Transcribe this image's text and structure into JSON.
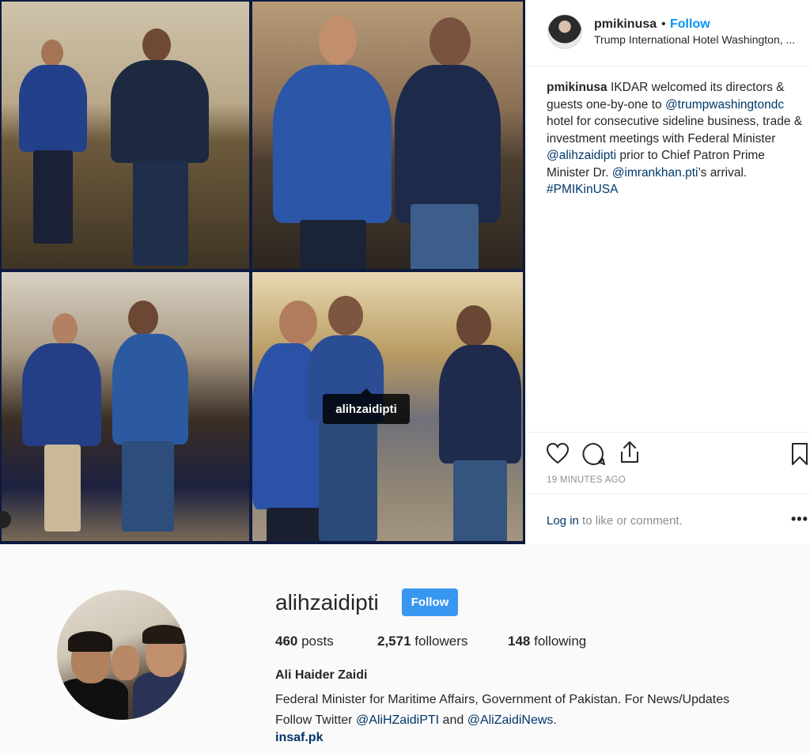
{
  "post": {
    "header": {
      "username": "pmikinusa",
      "separator": "•",
      "follow_label": "Follow",
      "location": "Trump International Hotel Washington, ..."
    },
    "caption": {
      "username": "pmikinusa",
      "text_1": " IKDAR welcomed its directors & guests one-by-one to ",
      "mention_1": "@trumpwashingtondc",
      "text_2": " hotel for consecutive sideline business, trade & investment meetings with Federal Minister ",
      "mention_2": "@alihzaidipti",
      "text_3": " prior to Chief Patron Prime Minister Dr. ",
      "mention_3": "@imrankhan.pti",
      "text_4": "’s arrival. ",
      "hashtag": "#PMIKinUSA"
    },
    "photo_tag": "alihzaidipti",
    "icons": [
      "heart-icon",
      "comment-icon",
      "share-icon",
      "bookmark-icon",
      "more-options-icon"
    ],
    "timestamp": "19 MINUTES AGO",
    "login_prompt": {
      "link": "Log in",
      "rest": " to like or comment.",
      "more": "•••"
    }
  },
  "profile": {
    "username": "alihzaidipti",
    "follow_label": "Follow",
    "stats": {
      "posts_count": "460",
      "posts_label": " posts",
      "followers_count": "2,571",
      "followers_label": " followers",
      "following_count": "148",
      "following_label": " following"
    },
    "full_name": "Ali Haider Zaidi",
    "bio_1": "Federal Minister for Maritime Affairs, Government of Pakistan. For News/Updates",
    "bio_2": "Follow Twitter ",
    "bio_link_1": "@AliHZaidiPTI",
    "bio_3": " and ",
    "bio_link_2": "@AliZaidiNews",
    "bio_4": ".",
    "website": "insaf.pk"
  },
  "colors": {
    "accent_blue": "#0095f6",
    "follow_button": "#3897f0",
    "link": "#00376b",
    "muted": "#8e8e8e"
  }
}
